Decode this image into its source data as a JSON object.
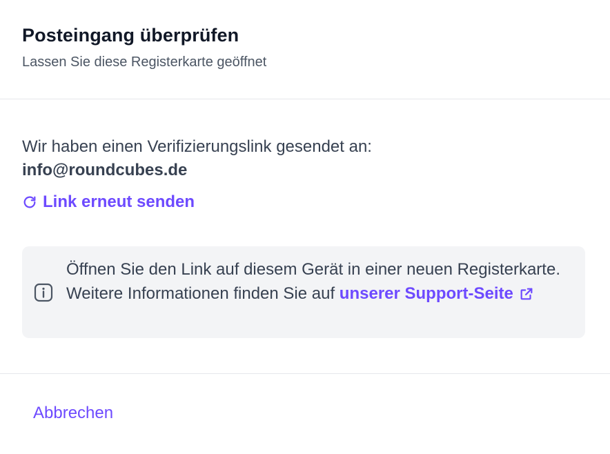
{
  "header": {
    "title": "Posteingang überprüfen",
    "subtitle": "Lassen Sie diese Registerkarte geöffnet"
  },
  "content": {
    "sent_text": "Wir haben einen Verifizierungslink gesendet an:",
    "email": "info@roundcubes.de",
    "resend_label": "Link erneut senden",
    "resend_icon": "refresh-icon"
  },
  "info": {
    "icon": "info-icon",
    "text": "Öffnen Sie den Link auf diesem Gerät in einer neuen Registerkarte. Weitere Informationen finden Sie auf",
    "link_label": "unserer Support-Seite",
    "link_icon": "external-link-icon"
  },
  "footer": {
    "cancel_label": "Abbrechen"
  },
  "colors": {
    "accent": "#6d4aff",
    "info_background": "#f3f4f6",
    "divider": "#e5e7eb"
  }
}
